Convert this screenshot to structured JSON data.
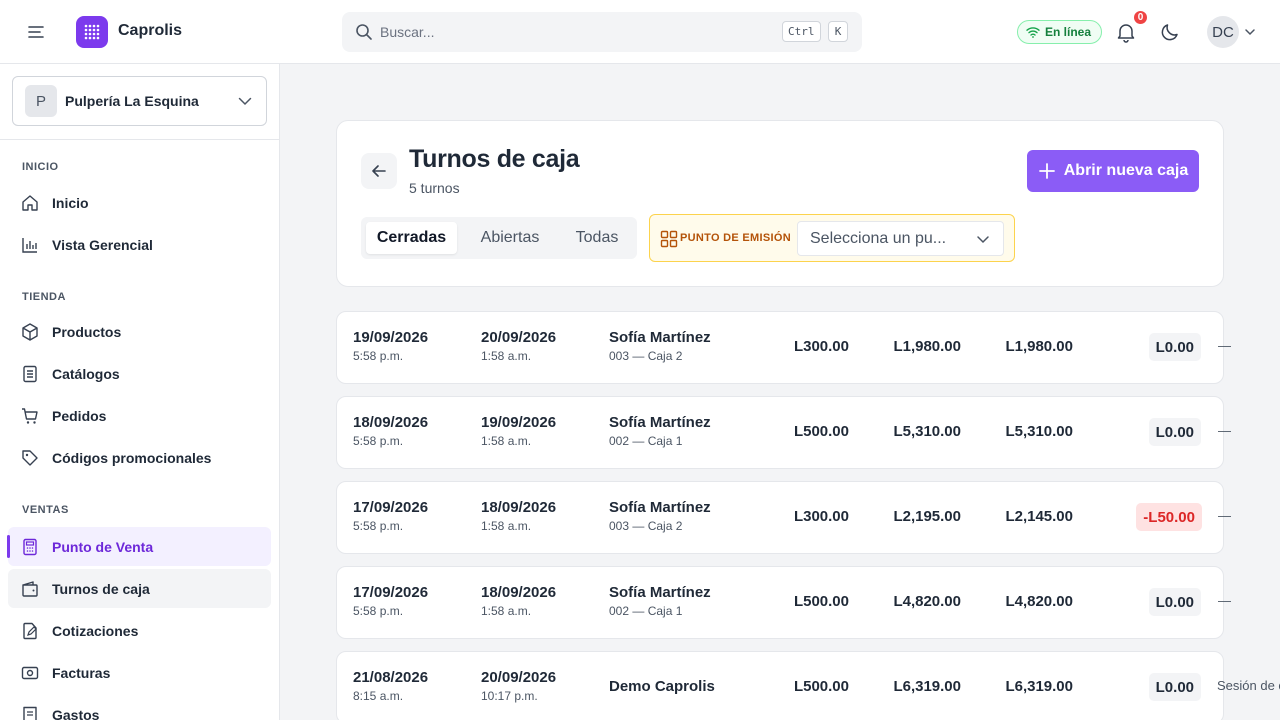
{
  "brand": {
    "name": "Caprolis"
  },
  "search": {
    "placeholder": "Buscar...",
    "kbd_1": "Ctrl",
    "kbd_2": "K"
  },
  "status": {
    "label": "En línea",
    "color": "#15803d"
  },
  "notifications": {
    "count": "0"
  },
  "user": {
    "initials": "DC"
  },
  "sidebar": {
    "store": {
      "initial": "P",
      "name": "Pulpería La Esquina"
    },
    "sections": {
      "inicio": "INICIO",
      "tienda": "TIENDA",
      "ventas": "VENTAS"
    },
    "items": {
      "inicio": "Inicio",
      "vista_gerencial": "Vista Gerencial",
      "productos": "Productos",
      "catalogos": "Catálogos",
      "pedidos": "Pedidos",
      "codigos": "Códigos promocionales",
      "punto_venta": "Punto de Venta",
      "turnos": "Turnos de caja",
      "cotizaciones": "Cotizaciones",
      "facturas": "Facturas",
      "gastos": "Gastos"
    }
  },
  "page": {
    "title": "Turnos de caja",
    "subtitle": "5 turnos",
    "primary_action": "Abrir nueva caja",
    "tabs": [
      "Cerradas",
      "Abiertas",
      "Todas"
    ],
    "active_tab": "Cerradas",
    "emission_label": "PUNTO DE EMISIÓN",
    "emission_value": "Selecciona un pu..."
  },
  "shifts": [
    {
      "open_date": "19/09/2026",
      "open_time": "5:58 p.m.",
      "close_date": "20/09/2026",
      "close_time": "1:58 a.m.",
      "cashier": "Sofía Martínez",
      "register": "003 — Caja 2",
      "opening": "L300.00",
      "expected": "L1,980.00",
      "counted": "L1,980.00",
      "difference": "L0.00",
      "trailing": "—"
    },
    {
      "open_date": "18/09/2026",
      "open_time": "5:58 p.m.",
      "close_date": "19/09/2026",
      "close_time": "1:58 a.m.",
      "cashier": "Sofía Martínez",
      "register": "002 — Caja 1",
      "opening": "L500.00",
      "expected": "L5,310.00",
      "counted": "L5,310.00",
      "difference": "L0.00",
      "trailing": "—"
    },
    {
      "open_date": "17/09/2026",
      "open_time": "5:58 p.m.",
      "close_date": "18/09/2026",
      "close_time": "1:58 a.m.",
      "cashier": "Sofía Martínez",
      "register": "003 — Caja 2",
      "opening": "L300.00",
      "expected": "L2,195.00",
      "counted": "L2,145.00",
      "difference": "-L50.00",
      "trailing": "—"
    },
    {
      "open_date": "17/09/2026",
      "open_time": "5:58 p.m.",
      "close_date": "18/09/2026",
      "close_time": "1:58 a.m.",
      "cashier": "Sofía Martínez",
      "register": "002 — Caja 1",
      "opening": "L500.00",
      "expected": "L4,820.00",
      "counted": "L4,820.00",
      "difference": "L0.00",
      "trailing": "—"
    },
    {
      "open_date": "21/08/2026",
      "open_time": "8:15 a.m.",
      "close_date": "20/09/2026",
      "close_time": "10:17 p.m.",
      "cashier": "Demo Caprolis",
      "register": "",
      "opening": "L500.00",
      "expected": "L6,319.00",
      "counted": "L6,319.00",
      "difference": "L0.00",
      "trailing": "Sesión de c"
    }
  ],
  "colors": {
    "accent": "#8b5cf6",
    "accent_dark": "#6d28d9",
    "negative": "#dc2626",
    "warning_bg": "#fffbeb"
  }
}
